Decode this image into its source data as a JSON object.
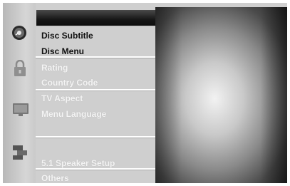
{
  "menu": {
    "items": [
      {
        "label": "Disc Subtitle"
      },
      {
        "label": "Disc Menu"
      },
      {
        "label": "Rating"
      },
      {
        "label": "Country Code"
      },
      {
        "label": "TV Aspect"
      },
      {
        "label": "Menu Language"
      },
      {
        "label": "5.1 Speaker Setup"
      },
      {
        "label": "Others"
      }
    ]
  },
  "icons": {
    "disc": "disc-icon",
    "lock": "lock-icon",
    "tv": "tv-icon",
    "speaker": "speaker-icon"
  },
  "colors": {
    "panel": "#cfcfcf",
    "header": "#171717",
    "active_text": "#111111",
    "dim_text": "#f4f4f4"
  }
}
